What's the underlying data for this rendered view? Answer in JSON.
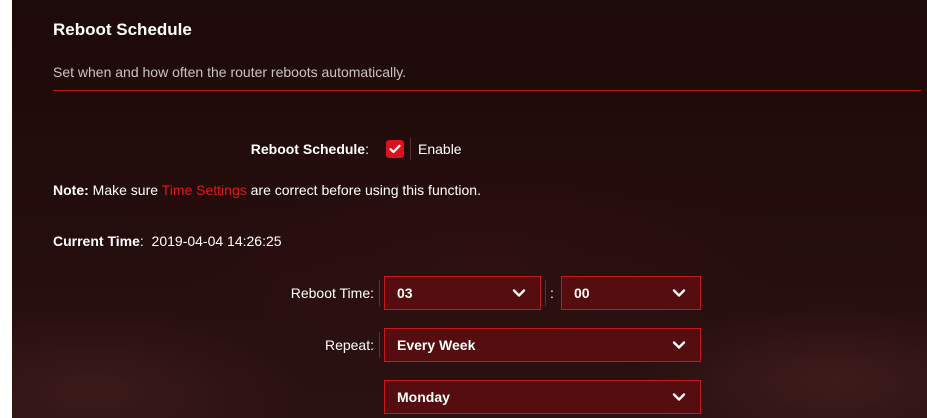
{
  "section": {
    "title": "Reboot Schedule",
    "description": "Set when and how often the router reboots automatically."
  },
  "schedule": {
    "label": "Reboot Schedule",
    "colon": ":",
    "enabled": true,
    "enable_label": "Enable"
  },
  "note": {
    "prefix": "Note:",
    "text_before": " Make sure ",
    "link": "Time Settings",
    "text_after": " are correct before using this function."
  },
  "current_time": {
    "label": "Current Time",
    "colon": ":",
    "value": "2019-04-04 14:26:25"
  },
  "reboot_time": {
    "label": "Reboot Time:",
    "hour": "03",
    "separator": ":",
    "minute": "00"
  },
  "repeat": {
    "label": "Repeat:",
    "frequency": "Every Week",
    "day": "Monday"
  },
  "colors": {
    "accent": "#e8141c",
    "select_bg": "#560d0f",
    "select_border": "#c41a1f"
  }
}
